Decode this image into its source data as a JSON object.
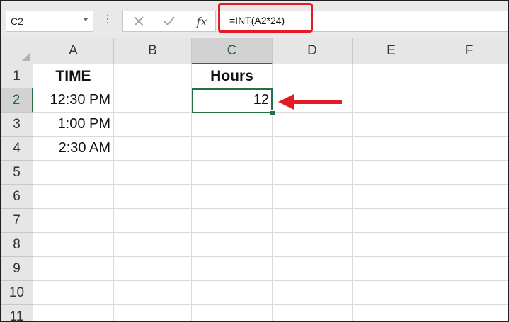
{
  "formula_bar": {
    "name_box": "C2",
    "fx_label": "fx",
    "formula": "=INT(A2*24)"
  },
  "columns": [
    "A",
    "B",
    "C",
    "D",
    "E",
    "F"
  ],
  "rows": [
    "1",
    "2",
    "3",
    "4",
    "5",
    "6",
    "7",
    "8",
    "9",
    "10",
    "11"
  ],
  "cells": {
    "A1": "TIME",
    "C1": "Hours",
    "A2": "12:30 PM",
    "C2": "12",
    "A3": "1:00 PM",
    "A4": "2:30 AM"
  },
  "selected_cell": "C2",
  "colors": {
    "highlight_red": "#e21b26",
    "selection_green": "#217346"
  },
  "icons": [
    "chevron-down-icon",
    "cancel-icon",
    "enter-check-icon",
    "fx-icon",
    "arrow-left-icon"
  ]
}
